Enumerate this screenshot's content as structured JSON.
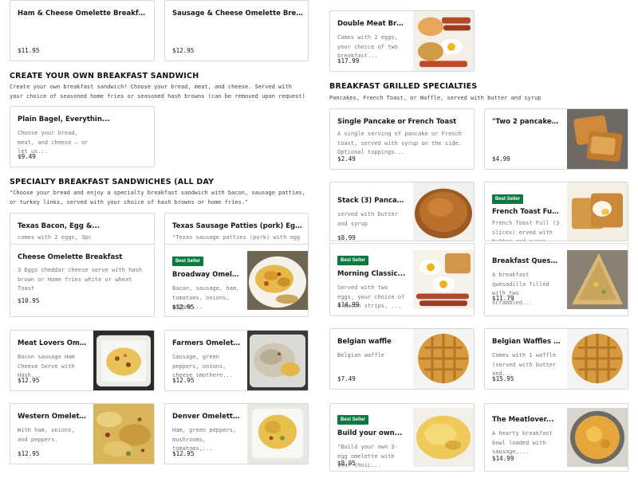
{
  "sections": {
    "sandwich": {
      "title": "CREATE YOUR OWN BREAKFAST SANDWICH",
      "description": "Create your own breakfast sandwich! Choose your bread, meat, and cheese. Served with your choice of seasoned home fries or seasoned hash browns (can be removed upon request)"
    },
    "specialty": {
      "title": "SPECIALTY BREAKFAST SANDWICHES (ALL DAY",
      "description": "\"Choose your bread and enjoy a specialty breakfast sandwich with bacon, sausage patties, or turkey links, served with your choice of hash browns or home fries.\""
    },
    "grilled": {
      "title": "BREAKFAST GRILLED SPECIALTIES",
      "description": "Pancakes, French Toast, or Waffle, served with butter and syrup"
    }
  },
  "items": {
    "ham_cheese_omelette": {
      "name": "Ham & Cheese Omelette Breakfast",
      "price": "$11.95"
    },
    "sausage_cheese_omelette": {
      "name": "Sausage & Cheese Omelette Breakfast",
      "price": "$12.95"
    },
    "double_meat": {
      "name": "Double Meat Breakfa...",
      "description": "Comes with 2 eggs, your choice of two breakfast...",
      "price": "$17.99",
      "image": "breakfast-platter-photo"
    },
    "plain_bagel": {
      "name": "Plain Bagel, Everythin...",
      "description": "Choose your bread, meat, and cheese – or let us...",
      "price": "$9.49"
    },
    "single_pancake": {
      "name": "Single Pancake or French Toast",
      "description": "A single serving of pancake or French toast, served with syrup on the side. Optional toppings...",
      "price": "$2.49"
    },
    "two_pancakes": {
      "name": "\"Two 2 pancakes or...",
      "price": "$4.99",
      "image": "french-toast-photo"
    },
    "texas_bacon": {
      "name": "Texas Bacon, Egg &...",
      "description": "comes with 2 eggs, 3pc"
    },
    "texas_sausage": {
      "name": "Texas Sausage Patties (pork) Egg, and...",
      "description": "\"Texas sausage patties (pork) with egg and cheese"
    },
    "stack_pancakes": {
      "name": "Stack (3) Pancakes",
      "description": "served with butter and syrup",
      "price": "$8.99",
      "image": "pancake-stack-photo"
    },
    "french_toast_full": {
      "badge": "Best Seller",
      "name": "French Toast Full (3...",
      "description": "French Toast Full (3 slices) erved with butter and syrup",
      "image": "french-toast-cream-photo"
    },
    "cheese_omelette": {
      "name": "Cheese Omelette Breakfast",
      "description": "3 Eggs cheddar cheese serve with hash brown or Home fries white or wheat Toast",
      "price": "$10.95"
    },
    "broadway_omelette": {
      "badge": "Best Seller",
      "name": "Broadway Omelette...",
      "description": "Bacon, sausage, ham, tomatoes, onions, pepper...",
      "price": "$12.95",
      "image": "omelette-plate-photo"
    },
    "morning_classic": {
      "badge": "Best Seller",
      "name": "Morning Classic...",
      "description": "Served with two eggs, your choice of 4 bacon strips, ...",
      "price": "$14.99",
      "image": "classic-breakfast-photo"
    },
    "breakfast_quesadilla": {
      "name": "Breakfast Quesadilla",
      "description": "A breakfast quesadilla filled with two scrambled...",
      "price": "$11.79",
      "image": "quesadilla-photo"
    },
    "meat_lovers": {
      "name": "Meat Lovers Omelett...",
      "description": "Bacon sausage Ham Cheese Serve with Hash...",
      "price": "$12.95",
      "image": "omelette-container-photo"
    },
    "farmers_omelette": {
      "name": "Farmers Omelette...",
      "description": "Sausage, green peppers, onions, cheese smothere...",
      "price": "$12.95",
      "image": "gravy-omelette-photo"
    },
    "belgian_waffle": {
      "name": "Belgian waffle",
      "description": "Belgian waffle",
      "price": "$7.49",
      "image": "waffle-photo"
    },
    "belgian_waffles_with": {
      "name": "Belgian Waffles with ...",
      "description": "Comes with 1 waffle (served with butter and...",
      "price": "$15.95",
      "image": "waffle-photo-2"
    },
    "western_omelette": {
      "name": "Western Omelette...",
      "description": "With ham, onions, and peppers.",
      "price": "$12.95",
      "image": "western-omelette-photo"
    },
    "denver_omelette": {
      "name": "Denver Omelette...",
      "description": "Ham, green peppers, mushrooms, tomatoes,...",
      "price": "$12.95",
      "image": "denver-omelette-photo"
    },
    "build_your_own": {
      "badge": "Best Seller",
      "name": "Build your own...",
      "description": "\"Build your own 3-egg omelette with your choic...",
      "price": "$8.95",
      "image": "folded-omelette-photo"
    },
    "meatlover": {
      "name": "The Meatlover...",
      "description": "A hearty breakfast bowl loaded with sausage,...",
      "price": "$14.99",
      "image": "breakfast-bowl-photo"
    }
  },
  "colors": {
    "badge": "#0a7a3f",
    "border": "#d9d9d9",
    "text": "#191919",
    "muted": "#767676"
  }
}
